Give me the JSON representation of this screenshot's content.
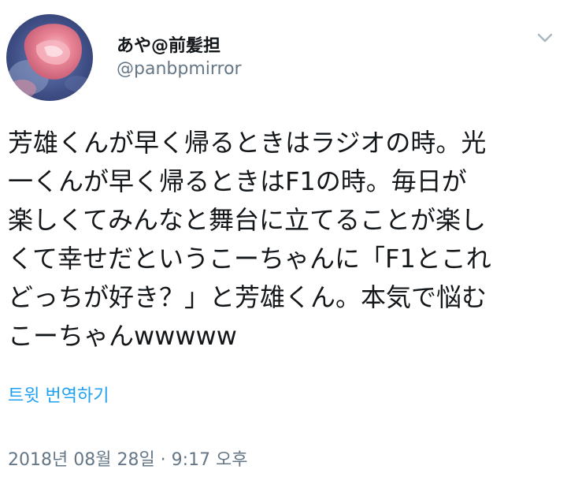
{
  "tweet": {
    "author": {
      "display_name": "あや@前髪担",
      "handle": "@panbpmirror",
      "avatar_icon": "profile-photo"
    },
    "menu_icon": "chevron-down-icon",
    "text_lines": [
      "芳雄くんが早く帰るときはラジオの時。光",
      "一くんが早く帰るときはF1の時。毎日が",
      "楽しくてみんなと舞台に立てることが楽し",
      "くて幸せだというこーちゃんに「F1とこれ",
      "どっちが好き？」と芳雄くん。本気で悩む",
      "こーちゃんwwwww"
    ],
    "translate_label": "트윗 번역하기",
    "timestamp": "2018년 08월 28일 · 9:17 오후"
  },
  "colors": {
    "text": "#14171a",
    "secondary": "#657786",
    "link": "#1da1f2",
    "chevron": "#aab8c2"
  }
}
